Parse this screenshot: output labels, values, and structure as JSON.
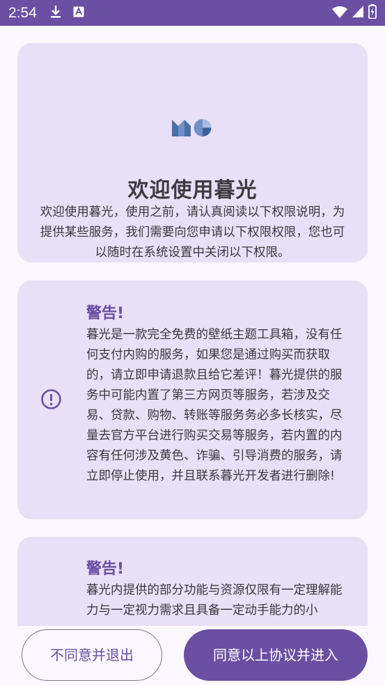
{
  "status_bar": {
    "time": "2:54",
    "icons": [
      "download-icon",
      "keyboard-a-icon",
      "wifi-icon",
      "signal-icon",
      "battery-charging-icon"
    ]
  },
  "welcome": {
    "logo_icon": "mg-logo-icon",
    "title": "欢迎使用暮光",
    "description": "欢迎使用暮光，使用之前，请认真阅读以下权限说明，为提供某些服务，我们需要向您申请以下权限权限，您也可以随时在系统设置中关闭以下权限。"
  },
  "warnings": [
    {
      "icon": "exclamation-circle-icon",
      "title": "警告!",
      "body": "暮光是一款完全免费的壁纸主题工具箱，没有任何支付内购的服务，如果您是通过购买而获取的，请立即申请退款且给它差评！暮光提供的服务中可能内置了第三方网页等服务，若涉及交易、贷款、购物、转账等服务务必多长核实，尽量去官方平台进行购买交易等服务，若内置的内容有任何涉及黄色、诈骗、引导消费的服务，请立即停止使用，并且联系暮光开发者进行删除!"
    },
    {
      "icon": "exclamation-circle-icon",
      "title": "警告!",
      "body": "暮光内提供的部分功能与资源仅限有一定理解能力与一定视力需求且具备一定动手能力的小"
    }
  ],
  "buttons": {
    "disagree": "不同意并退出",
    "agree": "同意以上协议并进入"
  },
  "colors": {
    "primary": "#6a4fa3",
    "card": "#e8e0f7",
    "background": "#fcf8ff"
  }
}
